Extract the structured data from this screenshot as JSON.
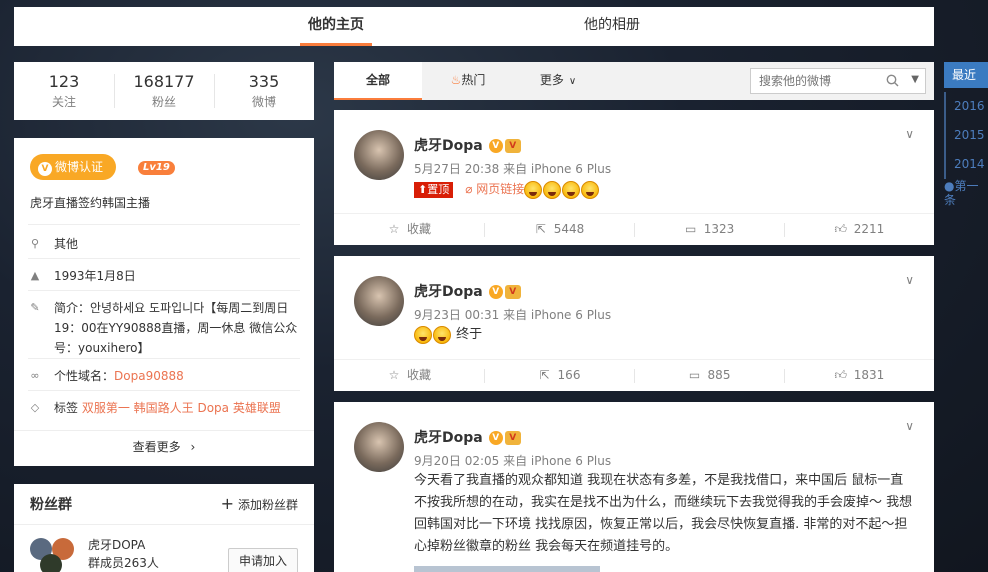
{
  "top_nav": {
    "tabs": [
      "他的主页",
      "他的相册"
    ]
  },
  "stats": [
    {
      "num": "123",
      "label": "关注"
    },
    {
      "num": "168177",
      "label": "粉丝"
    },
    {
      "num": "335",
      "label": "微博"
    }
  ],
  "profile": {
    "verify_label": "微博认证",
    "level": "Lv19",
    "verify_desc": "虎牙直播签约韩国主播",
    "location": "其他",
    "birthday": "1993年1月8日",
    "bio_prefix": "简介：",
    "bio": "안녕하세요 도파입니다【每周二到周日19：00在YY90888直播，周一休息 微信公众号：youxihero】",
    "domain_prefix": "个性域名：",
    "domain": "Dopa90888",
    "tags_prefix": "标签",
    "tags": "双服第一 韩国路人王 Dopa 英雄联盟",
    "more": "查看更多"
  },
  "fans_group": {
    "title": "粉丝群",
    "add": "添加粉丝群",
    "group_name": "虎牙DOPA",
    "group_count": "群成员263人",
    "join": "申请加入"
  },
  "feed_tabs": {
    "all": "全部",
    "hot": "热门",
    "more": "更多"
  },
  "search": {
    "placeholder": "搜索他的微博"
  },
  "posts": [
    {
      "name": "虎牙Dopa",
      "meta": "5月27日 20:38 来自 iPhone 6 Plus",
      "pin": "置顶",
      "weblink": "网页链接",
      "text": "",
      "favorite": "收藏",
      "repost": "5448",
      "comment": "1323",
      "like": "2211"
    },
    {
      "name": "虎牙Dopa",
      "meta": "9月23日 00:31 来自 iPhone 6 Plus",
      "text": "终于",
      "favorite": "收藏",
      "repost": "166",
      "comment": "885",
      "like": "1831"
    },
    {
      "name": "虎牙Dopa",
      "meta": "9月20日 02:05 来自 iPhone 6 Plus",
      "text": "今天看了我直播的观众都知道 我现在状态有多差，不是我找借口，来中国后 鼠标一直不按我所想的在动，我实在是找不出为什么，而继续玩下去我觉得我的手会废掉～ 我想回韩国对比一下环境 找找原因，恢复正常以后，我会尽快恢复直播. 非常的对不起～担心掉粉丝徽章的粉丝 我会每天在频道挂号的。"
    }
  ],
  "timeline": {
    "current": "最近",
    "years": [
      "2016",
      "2015",
      "2014"
    ],
    "first": "第一条"
  },
  "colors": {
    "accent": "#fa7d3c",
    "link_orange": "#eb7350",
    "verify_gold": "#f9a825",
    "timeline_blue": "#3b7bc1"
  }
}
